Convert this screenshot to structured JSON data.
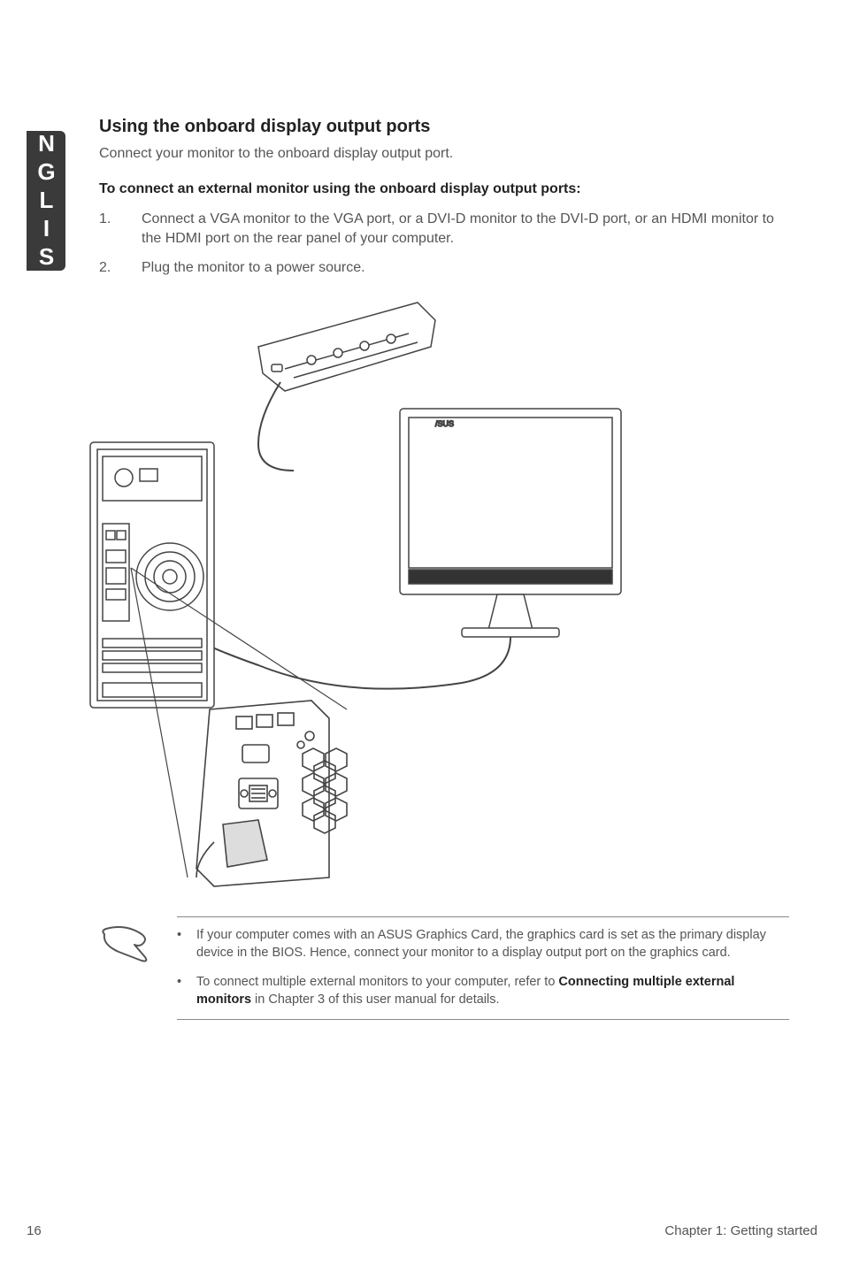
{
  "sideTab": "ENGLISH",
  "heading": "Using the onboard display output ports",
  "intro": "Connect your monitor to the onboard display output port.",
  "subhead": "To connect an external monitor using the onboard display output ports:",
  "steps": [
    {
      "num": "1.",
      "text": "Connect a VGA monitor to the VGA port, or a DVI-D monitor to the DVI-D port, or an HDMI monitor to the HDMI port on the rear panel of your computer."
    },
    {
      "num": "2.",
      "text": "Plug the monitor to a power source."
    }
  ],
  "notes": [
    {
      "pre": "If your computer comes with an ASUS Graphics Card, the graphics card is set as the primary display device in the BIOS. Hence, connect your monitor to a display output port on the graphics card.",
      "bold": "",
      "post": ""
    },
    {
      "pre": "To connect multiple external monitors to your computer, refer to ",
      "bold": "Connecting multiple external monitors",
      "post": " in Chapter 3 of this user manual for details."
    }
  ],
  "footer": {
    "pageNum": "16",
    "chapter": "Chapter 1: Getting started"
  }
}
